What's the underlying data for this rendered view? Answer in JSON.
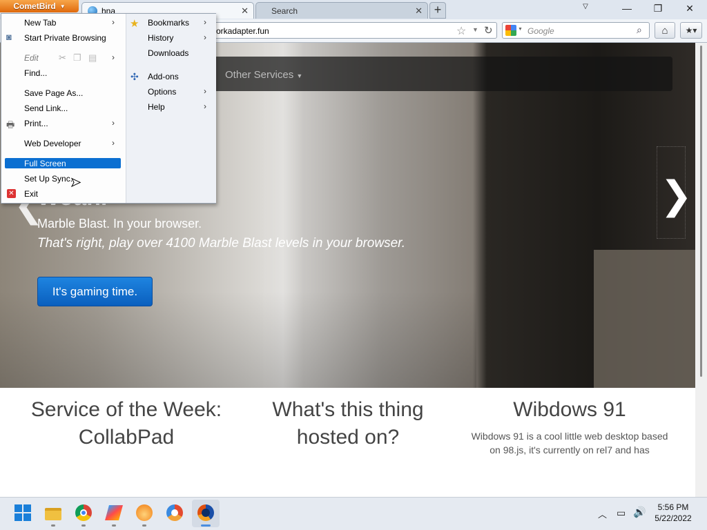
{
  "browser": {
    "app_button": "CometBird",
    "tabs": [
      {
        "title": "hna"
      },
      {
        "title": "Search"
      }
    ],
    "url": "orkadapter.fun",
    "search_placeholder": "Google"
  },
  "menu": {
    "left": [
      {
        "label": "New Tab",
        "has_submenu": true
      },
      {
        "label": "Start Private Browsing",
        "has_submenu": false
      },
      {
        "label": "Edit",
        "has_submenu": true,
        "disabled": true
      },
      {
        "label": "Find...",
        "has_submenu": false
      },
      {
        "label": "Save Page As...",
        "has_submenu": false
      },
      {
        "label": "Send Link...",
        "has_submenu": false
      },
      {
        "label": "Print...",
        "has_submenu": true
      },
      {
        "label": "Web Developer",
        "has_submenu": true
      },
      {
        "label": "Full Screen",
        "has_submenu": false,
        "highlighted": true
      },
      {
        "label": "Set Up Sync...",
        "has_submenu": false
      },
      {
        "label": "Exit",
        "has_submenu": false
      }
    ],
    "right": [
      {
        "label": "Bookmarks",
        "has_submenu": true
      },
      {
        "label": "History",
        "has_submenu": true
      },
      {
        "label": "Downloads",
        "has_submenu": false
      },
      {
        "label": "Add-ons",
        "has_submenu": false
      },
      {
        "label": "Options",
        "has_submenu": true
      },
      {
        "label": "Help",
        "has_submenu": true
      }
    ]
  },
  "page": {
    "nav_other_services": "Other Services",
    "headline": "Woah.",
    "tagline": "Marble Blast. In your browser.",
    "tagline_italic": "That's right, play over 4100 Marble Blast levels in your browser.",
    "cta": "It's gaming time.",
    "columns": [
      {
        "heading": "Service of the Week: CollabPad"
      },
      {
        "heading": "What's this thing hosted on?"
      },
      {
        "heading": "Wibdows 91",
        "text": "Wibdows 91 is a cool little web desktop based on 98.js, it's currently on rel7 and has"
      }
    ]
  },
  "taskbar": {
    "time": "5:56 PM",
    "date": "5/22/2022"
  }
}
